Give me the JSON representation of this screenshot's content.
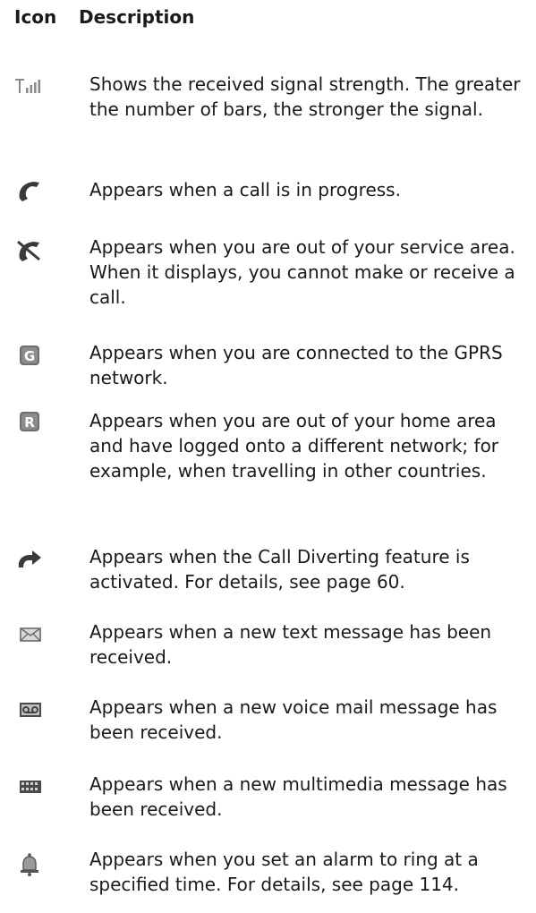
{
  "header": {
    "icon_label": "Icon",
    "description_label": "Description"
  },
  "rows": [
    {
      "icon": "signal-strength-icon",
      "text": "Shows the received signal strength. The greater the number of bars, the stronger the signal."
    },
    {
      "icon": "call-in-progress-icon",
      "text": "Appears when a call is in progress."
    },
    {
      "icon": "out-of-service-icon",
      "text": "Appears when you are out of your service area. When it displays, you cannot make or receive a call."
    },
    {
      "icon": "gprs-icon",
      "text": "Appears when you are connected to the GPRS network."
    },
    {
      "icon": "roaming-icon",
      "text": "Appears when you are out of your home area and have logged onto a different network; for example, when travelling in other countries."
    },
    {
      "icon": "call-divert-icon",
      "text": "Appears when the Call Diverting feature is activated. For details, see page 60."
    },
    {
      "icon": "text-message-icon",
      "text": "Appears when a new text message has been received."
    },
    {
      "icon": "voice-mail-icon",
      "text": "Appears when a new voice mail message has been received."
    },
    {
      "icon": "multimedia-message-icon",
      "text": "Appears when a new multimedia message has been received."
    },
    {
      "icon": "alarm-icon",
      "text": "Appears when you set an alarm to ring at a specified time. For details, see page 114."
    }
  ]
}
